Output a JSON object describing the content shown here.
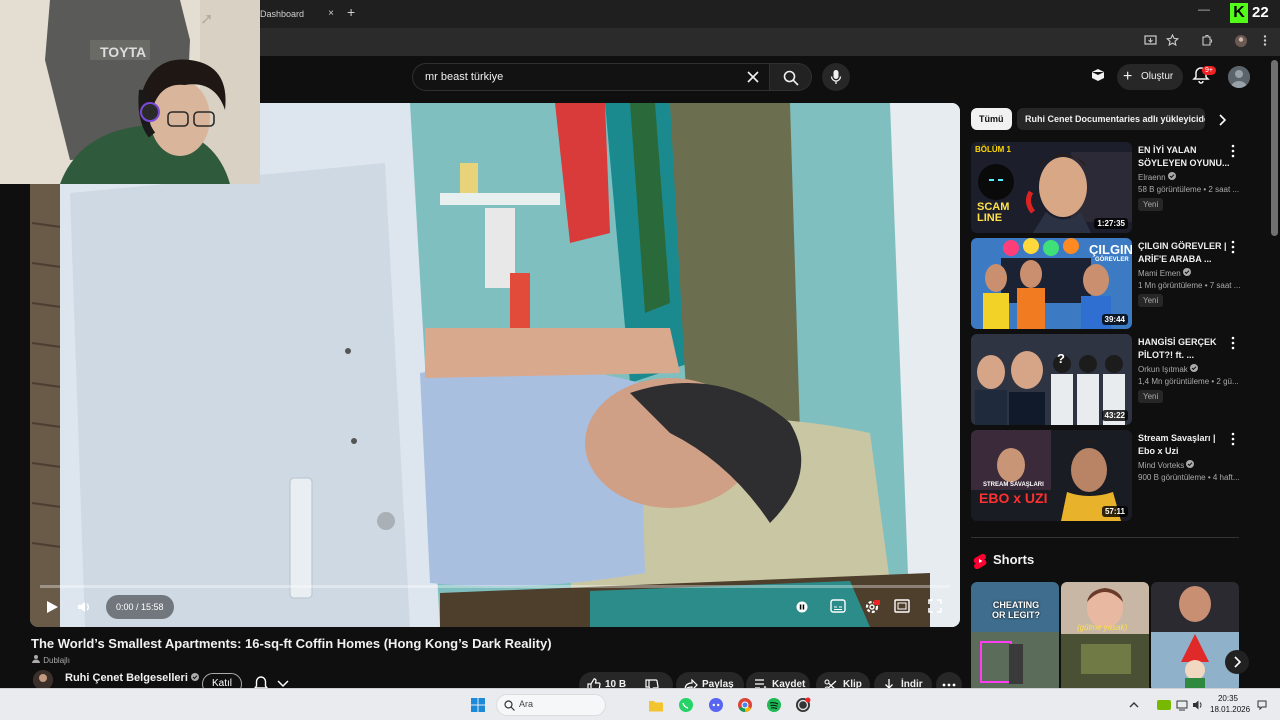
{
  "browser": {
    "tab_label": "Dashboard",
    "tab_close": "×",
    "new_tab": "+",
    "minimize": "—",
    "kick_letter": "K",
    "kick_count": "22"
  },
  "header": {
    "search_value": "mr beast türkiye",
    "create_label": "Oluştur",
    "notifications_badge": "9+"
  },
  "video": {
    "time": "0:00 / 15:58",
    "title": "The World’s Smallest Apartments: 16-sq-ft Coffin Homes (Hong Kong’s Dark Reality)",
    "dubbed_label": "Dublajlı",
    "channel_name": "Ruhi Çenet Belgeselleri",
    "join_label": "Katıl",
    "like_count": "10 B",
    "share_label": "Paylaş",
    "save_label": "Kaydet",
    "clip_label": "Klip",
    "download_label": "İndir"
  },
  "sidebar": {
    "chips": [
      "Tümü",
      "Ruhi Cenet Documentaries adlı yükleyiciden"
    ],
    "recommendations": [
      {
        "title": "EN İYİ YALAN SÖYLEYEN OYUNU...",
        "channel": "Elraenn",
        "meta": "58 B görüntüleme • 2 saat ...",
        "badge": "Yeni",
        "duration": "1:27:35",
        "thumb_text": "SCAM LINE",
        "thumb_tag": "BÖLÜM 1"
      },
      {
        "title": "ÇILGIN GÖREVLER | ARİF'E ARABA ...",
        "channel": "Mami Emen",
        "meta": "1 Mn görüntüleme • 7 saat ...",
        "badge": "Yeni",
        "duration": "39:44",
        "thumb_text": "ÇILGIN",
        "thumb_tag": "GÖREVLER"
      },
      {
        "title": "HANGİSİ GERÇEK PİLOT?! ft. ...",
        "channel": "Orkun Işıtmak",
        "meta": "1,4 Mn görüntüleme • 2 gü...",
        "badge": "Yeni",
        "duration": "43:22",
        "thumb_text": "?",
        "thumb_tag": ""
      },
      {
        "title": "Stream Savaşları | Ebo x Uzi",
        "channel": "Mind Vorteks",
        "meta": "900 B görüntüleme • 4 haft...",
        "badge": "",
        "duration": "57:11",
        "thumb_text": "EBO x UZI",
        "thumb_tag": "STREAM SAVAŞLARI"
      }
    ],
    "shorts_title": "Shorts",
    "shorts_texts": [
      "CHEATING OR LEGIT?",
      "(gülme yasak)"
    ]
  },
  "taskbar": {
    "search_placeholder": "Ara",
    "time": "20:35",
    "date": "18.01.2026"
  }
}
